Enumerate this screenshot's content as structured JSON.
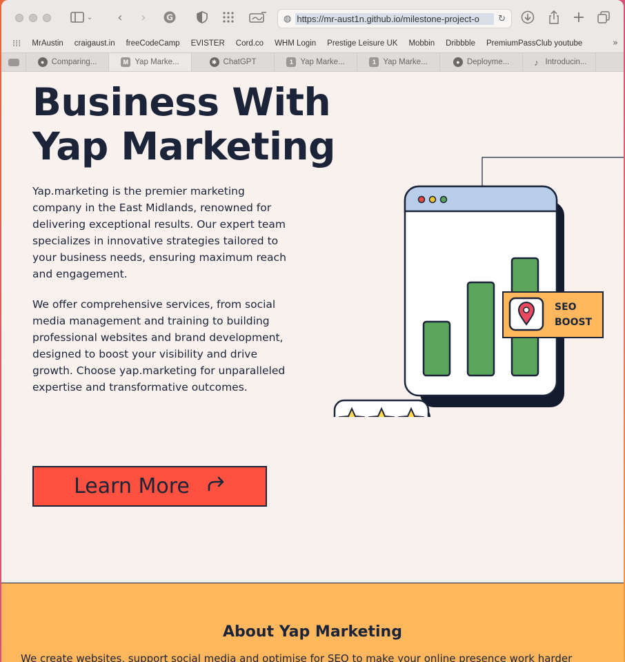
{
  "browser": {
    "url": "https://mr-aust1n.github.io/milestone-project-o",
    "bookmarks": [
      "MrAustin",
      "craigaust.in",
      "freeCodeCamp",
      "EVISTER",
      "Cord.co",
      "WHM Login",
      "Prestige Leisure UK",
      "Mobbin",
      "Dribbble",
      "PremiumPassClub youtube"
    ],
    "tabs": [
      {
        "label": "Comparing...",
        "icon": "github-icon"
      },
      {
        "label": "Yap Marke...",
        "icon": "M",
        "active": true
      },
      {
        "label": "ChatGPT",
        "icon": "chatgpt-icon"
      },
      {
        "label": "Yap Marke...",
        "icon": "1"
      },
      {
        "label": "Yap Marke...",
        "icon": "1"
      },
      {
        "label": "Deployme...",
        "icon": "github-icon"
      },
      {
        "label": "Introducin...",
        "icon": "tiktok-icon"
      }
    ]
  },
  "hero": {
    "title_line1": "Business With",
    "title_line2": "Yap Marketing",
    "paragraph1": "Yap.marketing is the premier marketing company in the East Midlands, renowned for delivering exceptional results. Our expert team specializes in innovative strategies tailored to your business needs, ensuring maximum reach and engagement.",
    "paragraph2": "We offer comprehensive services, from social media management and training to building professional websites and brand development, designed to boost your visibility and drive growth. Choose yap.marketing for unparalleled expertise and transformative outcomes.",
    "button_label": "Learn More",
    "button_icon": "share-arrow-icon"
  },
  "illustration": {
    "badge_line1": "SEO",
    "badge_line2": "BOOST",
    "colors": {
      "bar": "#5ba55a",
      "window_header": "#b7cdea",
      "badge": "#ffb75e",
      "navy": "#1b2438",
      "star": "#ffd84d"
    }
  },
  "about": {
    "heading": "About Yap Marketing",
    "cut_text": "We create websites, support social media and optimise for SEO to make your online presence work harder"
  },
  "colors": {
    "accent": "#ff5140",
    "page_bg": "#f8f1ee",
    "about_bg": "#ffb75e",
    "navy": "#1b2438"
  }
}
